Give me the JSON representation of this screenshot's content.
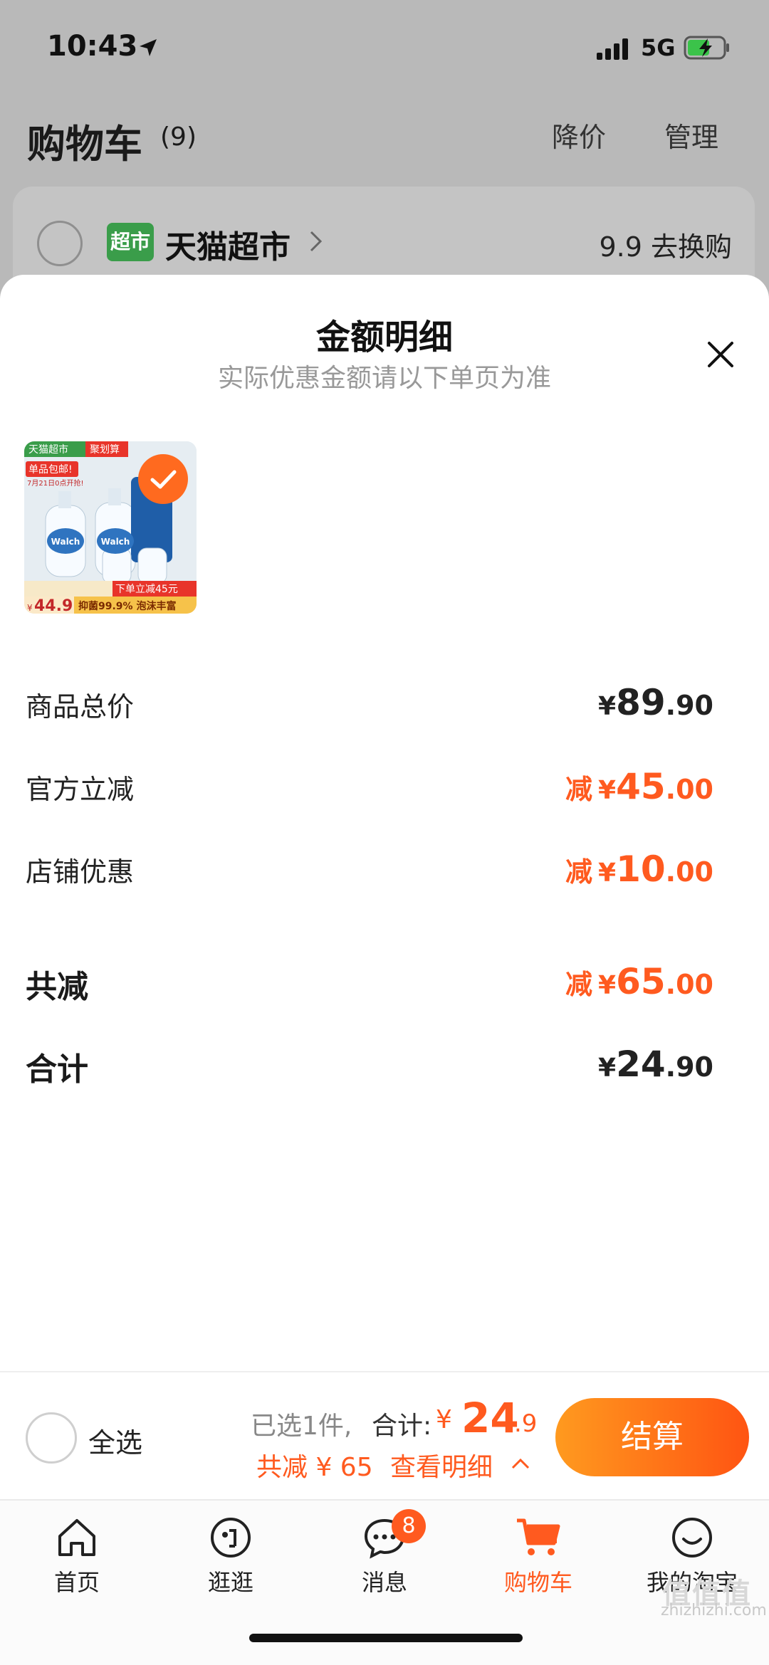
{
  "status_bar": {
    "time": "10:43",
    "network": "5G"
  },
  "header": {
    "title": "购物车",
    "count": "(9)",
    "price_drop": "降价",
    "manage": "管理"
  },
  "store": {
    "logo_text": "超市",
    "name": "天猫超市",
    "promo": "9.9 去换购"
  },
  "sheet": {
    "title": "金额明细",
    "subtitle": "实际优惠金额请以下单页为准",
    "product": {
      "tag_store": "天猫超市",
      "tag_live": "聚划算",
      "tag_free": "单品包邮!",
      "tag_date": "7月21日0点开抢!",
      "price_prefix": "¥",
      "price": "44.9",
      "promo_banner": "下单立减45元",
      "bottom_banner": "抑菌99.9% 泡沫丰富",
      "brand": "Walch"
    },
    "rows": [
      {
        "label": "商品总价",
        "prefix": "",
        "currency": "¥",
        "int": "89",
        "dec": ".90",
        "accent": false,
        "big": false
      },
      {
        "label": "官方立减",
        "prefix": "减",
        "currency": "¥",
        "int": "45",
        "dec": ".00",
        "accent": true,
        "big": false
      },
      {
        "label": "店铺优惠",
        "prefix": "减",
        "currency": "¥",
        "int": "10",
        "dec": ".00",
        "accent": true,
        "big": false
      },
      {
        "label": "共减",
        "prefix": "减",
        "currency": "¥",
        "int": "65",
        "dec": ".00",
        "accent": true,
        "big": true
      },
      {
        "label": "合计",
        "prefix": "",
        "currency": "¥",
        "int": "24",
        "dec": ".90",
        "accent": false,
        "big": true
      }
    ]
  },
  "bottom_bar": {
    "select_all": "全选",
    "selected": "已选1件,",
    "total_label": "合计:",
    "total_currency": "¥",
    "total_int": "24",
    "total_dec": ".9",
    "saving": "共减 ¥ 65",
    "detail_link": "查看明细",
    "checkout": "结算"
  },
  "tabs": [
    {
      "label": "首页",
      "icon": "home-icon",
      "active": false
    },
    {
      "label": "逛逛",
      "icon": "browse-icon",
      "active": false
    },
    {
      "label": "消息",
      "icon": "message-icon",
      "active": false,
      "badge": "8"
    },
    {
      "label": "购物车",
      "icon": "cart-icon",
      "active": true
    },
    {
      "label": "我的淘宝",
      "icon": "profile-icon",
      "active": false
    }
  ],
  "watermark": {
    "logo": "值值值",
    "url": "zhizhizhi.com"
  },
  "colors": {
    "accent": "#ff5a1f",
    "checkout_start": "#ff9a1f",
    "checkout_end": "#ff5412"
  }
}
